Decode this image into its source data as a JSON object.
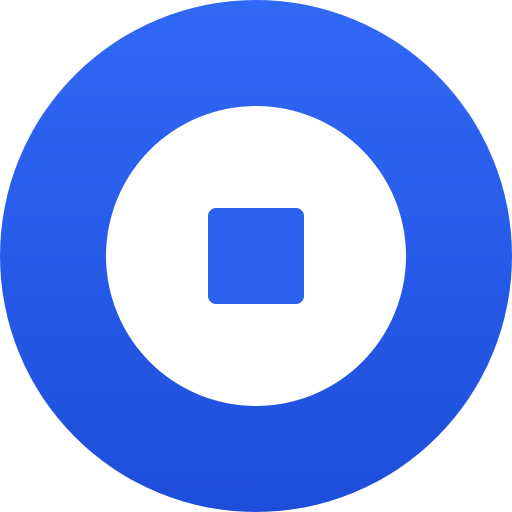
{
  "icon": {
    "name": "stop-button-icon",
    "colors": {
      "gradient_top": "#3168F5",
      "gradient_bottom": "#1E4DDB",
      "inner_ring": "#FFFFFF",
      "stop_square": "#2D62EE"
    }
  }
}
